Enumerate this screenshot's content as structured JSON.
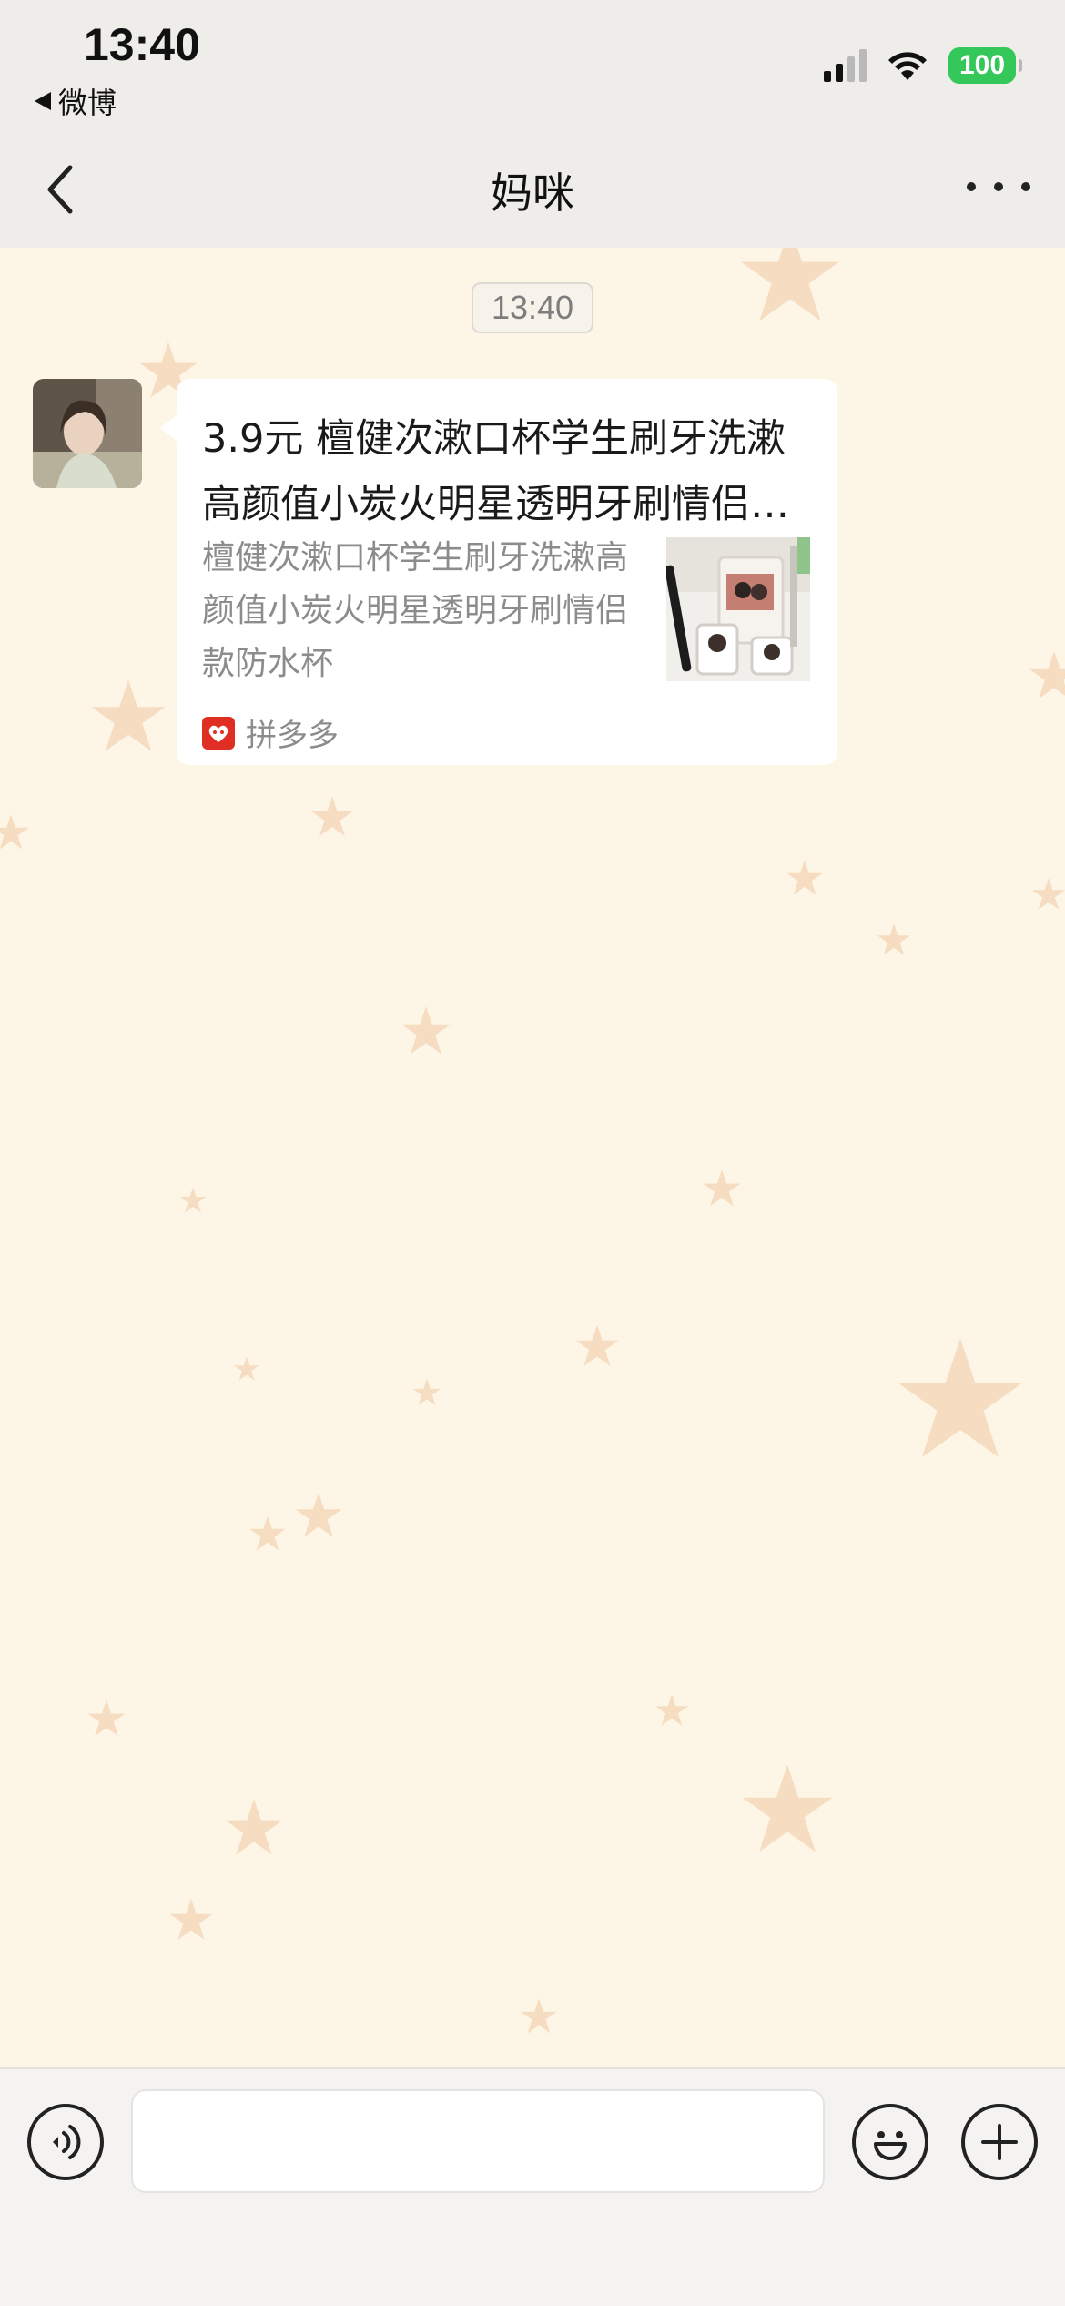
{
  "status_bar": {
    "time": "13:40",
    "back_app": "微博",
    "battery": "100"
  },
  "header": {
    "title": "妈咪",
    "back_icon": "chevron-left-icon",
    "more_icon": "more-dots-icon"
  },
  "chat": {
    "timestamp": "13:40",
    "messages": [
      {
        "sender": "妈咪",
        "type": "product-card",
        "title": "3.9元 檀健次漱口杯学生刷牙洗漱高颜值小炭火明星透明牙刷情侣款防水杯",
        "description": "檀健次漱口杯学生刷牙洗漱高颜值小炭火明星透明牙刷情侣款防水杯",
        "source": "拼多多"
      }
    ]
  },
  "input_bar": {
    "value": "",
    "voice_icon": "voice-icon",
    "emoji_icon": "emoji-icon",
    "plus_icon": "plus-icon"
  },
  "colors": {
    "chat_background": "#fdf6e6",
    "star": "#f4d3b2",
    "battery": "#34c759",
    "pinduoduo": "#e02e24"
  }
}
